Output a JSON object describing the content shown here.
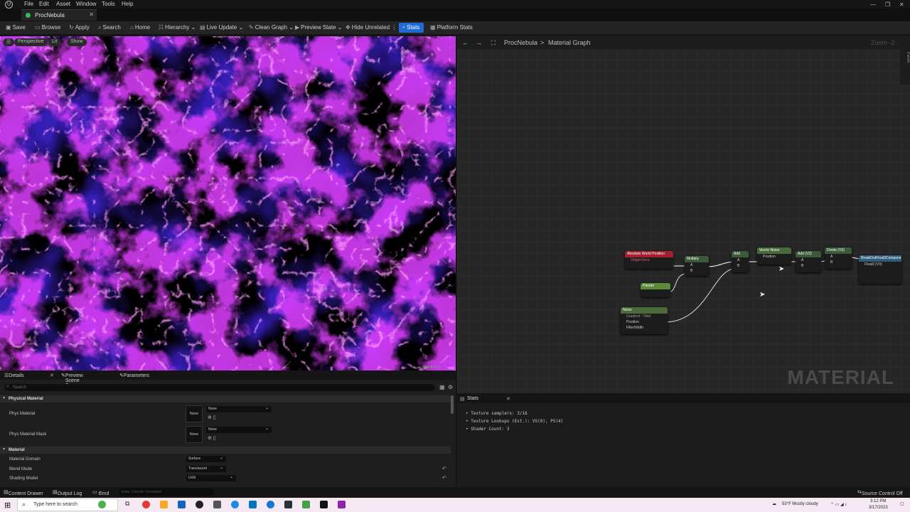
{
  "menu": {
    "items": [
      "File",
      "Edit",
      "Asset",
      "Window",
      "Tools",
      "Help"
    ]
  },
  "tab": {
    "title": "ProcNebula"
  },
  "toolbar": {
    "save": "Save",
    "browse": "Browse",
    "apply": "Apply",
    "search": "Search",
    "home": "Home",
    "hierarchy": "Hierarchy",
    "live_update": "Live Update",
    "clean_graph": "Clean Graph",
    "preview_state": "Preview State",
    "hide_unrelated": "Hide Unrelated",
    "stats": "Stats",
    "platform_stats": "Platform Stats"
  },
  "viewport": {
    "perspective": "Perspective",
    "lit": "Lit",
    "show": "Show"
  },
  "graph": {
    "breadcrumb_root": "ProcNebula",
    "breadcrumb_sep": ">",
    "breadcrumb_page": "Material Graph",
    "zoom": "Zoom -2",
    "palette": "Palette",
    "watermark": "MATERIAL",
    "nodes": {
      "absolute_world_position": "Absolute World Position",
      "absolute_world_position_sub": "Origin=Zero",
      "multiply": "Multiply",
      "add": "Add",
      "panner": "Panner",
      "noise": "Noise",
      "noise_sub": "Gradient - Tiled",
      "vector_noise": "Vector Noise",
      "add2": "Add (V3)",
      "divide": "Divide (V3)",
      "break_out": "BreakOutFloat3Components",
      "pin_a": "A",
      "pin_b": "B",
      "pin_position": "Position",
      "pin_filterwidth": "FilterWidth",
      "pin_float3": "Float3 (V3)"
    }
  },
  "details": {
    "tabs": [
      "Details",
      "Preview Scene S...",
      "Parameters"
    ],
    "search_placeholder": "Search",
    "physical_material": {
      "category": "Physical Material",
      "phys_material_label": "Phys Material",
      "phys_material_value": "None",
      "phys_material_thumb": "None",
      "phys_mask_label": "Phys Material Mask",
      "phys_mask_value": "None",
      "phys_mask_thumb": "None"
    },
    "material": {
      "category": "Material",
      "domain_label": "Material Domain",
      "domain_value": "Surface",
      "blend_label": "Blend Mode",
      "blend_value": "Translucent",
      "shading_label": "Shading Model",
      "shading_value": "Unlit"
    }
  },
  "stats": {
    "title": "Stats",
    "lines": [
      "Texture samplers: 3/16",
      "Texture Lookups (Est.): VS(0), PS(4)",
      "Shader Count: 3"
    ]
  },
  "bottom": {
    "content_drawer": "Content Drawer",
    "output_log": "Output Log",
    "cmd": "Cmd",
    "console_placeholder": "Enter Console Command",
    "source_control": "Source Control Off"
  },
  "taskbar": {
    "search_placeholder": "Type here to search",
    "weather": "53°F  Mostly cloudy",
    "time": "3:12 PM",
    "date": "3/17/2023"
  },
  "colors": {
    "accent": "#1e6bd6",
    "nebula_magenta": "#e040ff",
    "nebula_blue": "#3a20c8",
    "position_node": "#a3202f",
    "panner_node": "#5a8a3a"
  }
}
